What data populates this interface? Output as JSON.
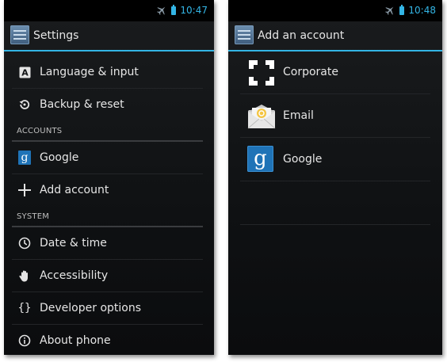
{
  "colors": {
    "accent": "#33b5e5",
    "background": "#121416",
    "text": "#e6e6e6"
  },
  "left_screen": {
    "status_time": "10:47",
    "title": "Settings",
    "items_top": [
      {
        "label": "Language & input",
        "icon": "keyboard-a-icon"
      },
      {
        "label": "Backup & reset",
        "icon": "backup-restore-icon"
      }
    ],
    "section_accounts": "ACCOUNTS",
    "items_accounts": [
      {
        "label": "Google",
        "icon": "google-icon"
      },
      {
        "label": "Add account",
        "icon": "plus-icon"
      }
    ],
    "section_system": "SYSTEM",
    "items_system": [
      {
        "label": "Date & time",
        "icon": "clock-icon"
      },
      {
        "label": "Accessibility",
        "icon": "hand-icon"
      },
      {
        "label": "Developer options",
        "icon": "braces-icon"
      },
      {
        "label": "About phone",
        "icon": "info-icon"
      }
    ]
  },
  "right_screen": {
    "status_time": "10:48",
    "title": "Add an account",
    "items": [
      {
        "label": "Corporate",
        "icon": "corporate-icon"
      },
      {
        "label": "Email",
        "icon": "email-icon"
      },
      {
        "label": "Google",
        "icon": "google-icon"
      }
    ]
  }
}
